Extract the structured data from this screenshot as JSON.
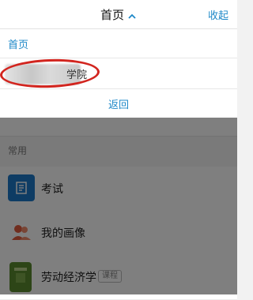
{
  "header": {
    "title": "首页",
    "collapse_label": "收起"
  },
  "menu": {
    "home_item": "首页",
    "institution_suffix": "学院",
    "back_label": "返回"
  },
  "background": {
    "section_label": "常用",
    "items": [
      {
        "label": "考试",
        "icon": "exam-icon"
      },
      {
        "label": "我的画像",
        "icon": "profile-portrait-icon"
      },
      {
        "label": "劳动经济学",
        "icon": "course-thumbnail",
        "tag": "课程"
      }
    ]
  },
  "colors": {
    "accent": "#1e88c8",
    "annotation": "#d2251f"
  }
}
